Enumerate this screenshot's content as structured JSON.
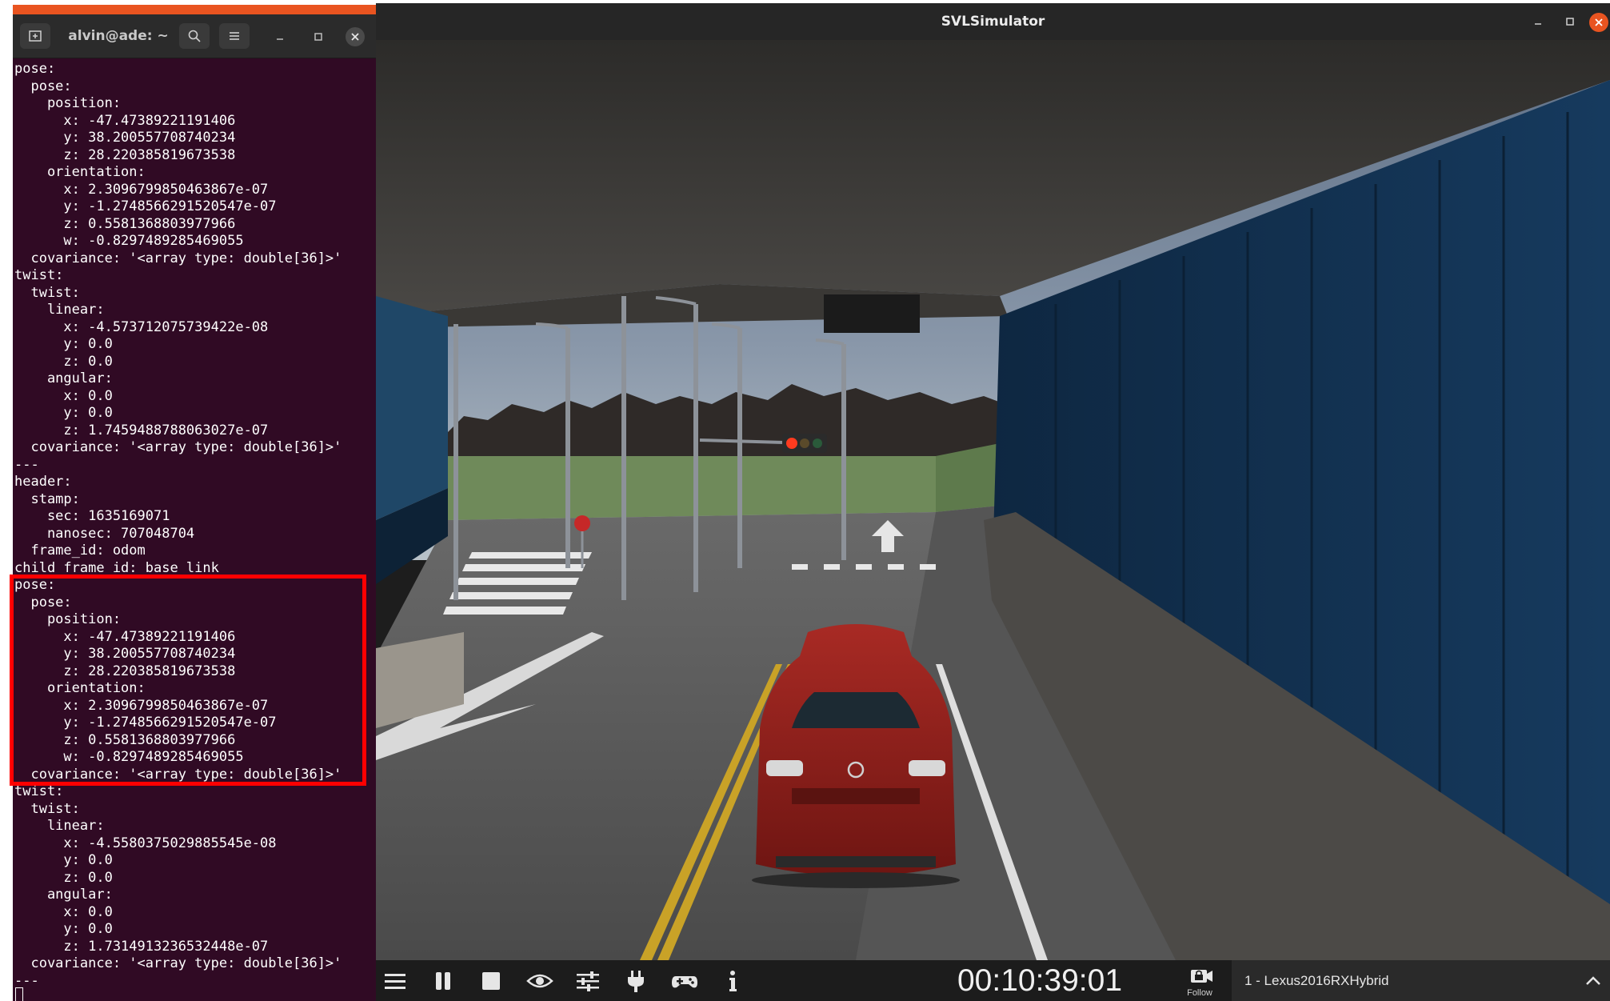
{
  "terminal": {
    "title": "alvin@ade: ~",
    "accent_color": "#e95420",
    "background_color": "#300a24",
    "lines": [
      "pose:",
      "  pose:",
      "    position:",
      "      x: -47.47389221191406",
      "      y: 38.200557708740234",
      "      z: 28.220385819673538",
      "    orientation:",
      "      x: 2.3096799850463867e-07",
      "      y: -1.2748566291520547e-07",
      "      z: 0.5581368803977966",
      "      w: -0.8297489285469055",
      "  covariance: '<array type: double[36]>'",
      "twist:",
      "  twist:",
      "    linear:",
      "      x: -4.573712075739422e-08",
      "      y: 0.0",
      "      z: 0.0",
      "    angular:",
      "      x: 0.0",
      "      y: 0.0",
      "      z: 1.7459488788063027e-07",
      "  covariance: '<array type: double[36]>'",
      "---",
      "header:",
      "  stamp:",
      "    sec: 1635169071",
      "    nanosec: 707048704",
      "  frame_id: odom",
      "child_frame_id: base_link",
      "pose:",
      "  pose:",
      "    position:",
      "      x: -47.47389221191406",
      "      y: 38.200557708740234",
      "      z: 28.220385819673538",
      "    orientation:",
      "      x: 2.3096799850463867e-07",
      "      y: -1.2748566291520547e-07",
      "      z: 0.5581368803977966",
      "      w: -0.8297489285469055",
      "  covariance: '<array type: double[36]>'",
      "twist:",
      "  twist:",
      "    linear:",
      "      x: -4.5580375029885545e-08",
      "      y: 0.0",
      "      z: 0.0",
      "    angular:",
      "      x: 0.0",
      "      y: 0.0",
      "      z: 1.7314913236532448e-07",
      "  covariance: '<array type: double[36]>'",
      "---"
    ],
    "highlight_color": "#ff0000"
  },
  "simulator": {
    "title": "SVLSimulator",
    "close_color": "#e95420",
    "sim_time": "00:10:39:01",
    "follow_label": "Follow",
    "vehicle": "1 - Lexus2016RXHybrid",
    "toolbar_icons": [
      "menu-icon",
      "pause-icon",
      "stop-icon",
      "visibility-icon",
      "settings-sliders-icon",
      "plug-icon",
      "gamepad-icon",
      "info-icon"
    ],
    "scene": {
      "vehicle_color": "#8e1d1a",
      "traffic_light_state": "red"
    }
  }
}
